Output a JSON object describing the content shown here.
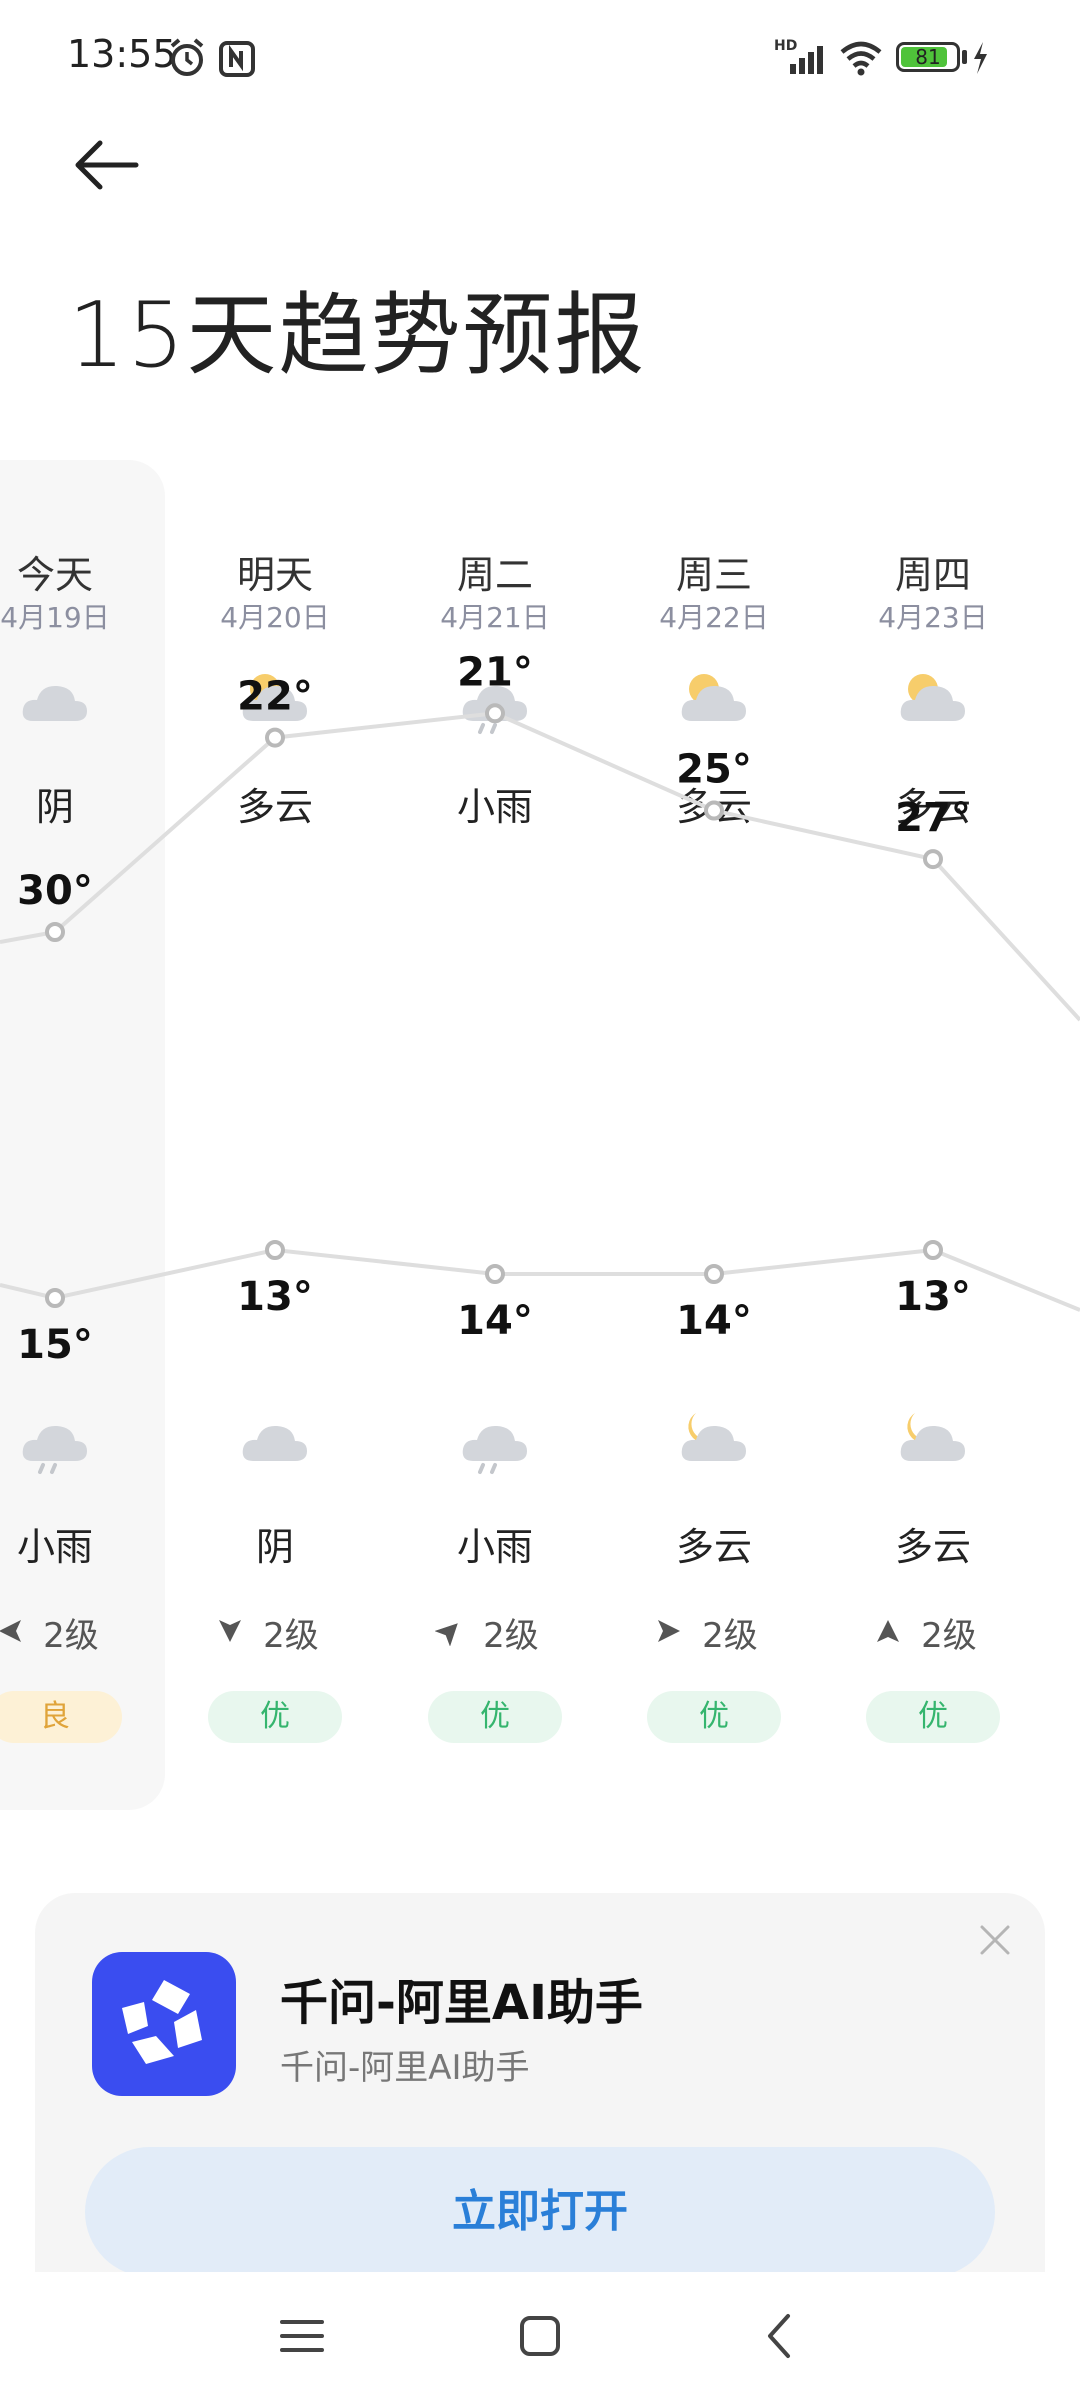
{
  "status_bar": {
    "time": "13:55",
    "battery": "81",
    "network": "HD"
  },
  "header": {
    "title": "15天趋势预报"
  },
  "days": [
    {
      "day": "今天",
      "date": "4月19日",
      "day_condition": "阴",
      "day_icon": "cloudy-icon",
      "high": "30°",
      "low": "15°",
      "night_icon": "rain-icon",
      "night_condition": "小雨",
      "wind": "2级",
      "wind_dir_icon": "wind-west-icon",
      "aqi": "良",
      "aqi_level": "fair"
    },
    {
      "day": "明天",
      "date": "4月20日",
      "day_condition": "多云",
      "day_icon": "partly-cloudy-day-icon",
      "high": "22°",
      "low": "13°",
      "night_icon": "cloudy-icon",
      "night_condition": "阴",
      "wind": "2级",
      "wind_dir_icon": "wind-south-icon",
      "aqi": "优",
      "aqi_level": "good"
    },
    {
      "day": "周二",
      "date": "4月21日",
      "day_condition": "小雨",
      "day_icon": "rain-icon",
      "high": "21°",
      "low": "14°",
      "night_icon": "rain-icon",
      "night_condition": "小雨",
      "wind": "2级",
      "wind_dir_icon": "wind-northeast-icon",
      "aqi": "优",
      "aqi_level": "good"
    },
    {
      "day": "周三",
      "date": "4月22日",
      "day_condition": "多云",
      "day_icon": "partly-cloudy-day-icon",
      "high": "25°",
      "low": "14°",
      "night_icon": "partly-cloudy-night-icon",
      "night_condition": "多云",
      "wind": "2级",
      "wind_dir_icon": "wind-east-icon",
      "aqi": "优",
      "aqi_level": "good"
    },
    {
      "day": "周四",
      "date": "4月23日",
      "day_condition": "多云",
      "day_icon": "partly-cloudy-day-icon",
      "high": "27°",
      "low": "13°",
      "night_icon": "partly-cloudy-night-icon",
      "night_condition": "多云",
      "wind": "2级",
      "wind_dir_icon": "wind-north-icon",
      "aqi": "优",
      "aqi_level": "good"
    }
  ],
  "chart_data": {
    "type": "line",
    "categories": [
      "今天",
      "明天",
      "周二",
      "周三",
      "周四"
    ],
    "series": [
      {
        "values": [
          30,
          22,
          21,
          25,
          27
        ]
      },
      {
        "values": [
          15,
          13,
          14,
          14,
          13
        ]
      }
    ]
  },
  "promo": {
    "title": "千问-阿里AI助手",
    "subtitle": "千问-阿里AI助手",
    "open_label": "立即打开"
  },
  "colors": {
    "aqi_good_bg": "#e8f7ee",
    "aqi_good_text": "#35b56e",
    "aqi_fair_bg": "#fdf1d6",
    "aqi_fair_text": "#e0a43a",
    "accent_blue": "#2a7fd8",
    "logo_blue": "#3a4df0"
  }
}
